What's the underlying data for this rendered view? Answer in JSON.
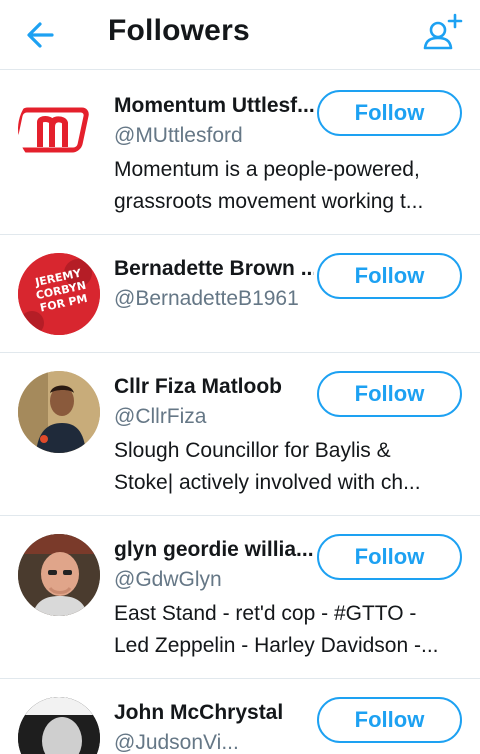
{
  "header": {
    "title": "Followers",
    "back_icon": "arrow-left-icon",
    "add_icon": "add-user-icon",
    "accent": "#1da1f2"
  },
  "followers": [
    {
      "name": "Momentum Uttlesf...",
      "handle": "@MUttlesford",
      "bio_lines": [
        "Momentum is a people-powered,",
        "grassroots movement working t..."
      ],
      "button": "Follow",
      "avatar_text": "m"
    },
    {
      "name": "Bernadette Brown ...",
      "handle": "@BernadetteB1961",
      "bio_lines": [],
      "button": "Follow",
      "avatar_text": [
        "JEREMY",
        "CORBYN",
        "FOR PM"
      ]
    },
    {
      "name": "Cllr Fiza Matloob",
      "handle": "@CllrFiza",
      "bio_lines": [
        "Slough Councillor for Baylis &",
        "Stoke| actively involved with ch..."
      ],
      "button": "Follow"
    },
    {
      "name": "glyn geordie willia...",
      "handle": "@GdwGlyn",
      "bio_lines": [
        "East Stand - ret'd cop - #GTTO -",
        "Led Zeppelin - Harley Davidson -..."
      ],
      "button": "Follow"
    },
    {
      "name": "John McChrystal",
      "handle": "@JudsonVi...",
      "bio_lines": [],
      "button": "Follow"
    }
  ]
}
